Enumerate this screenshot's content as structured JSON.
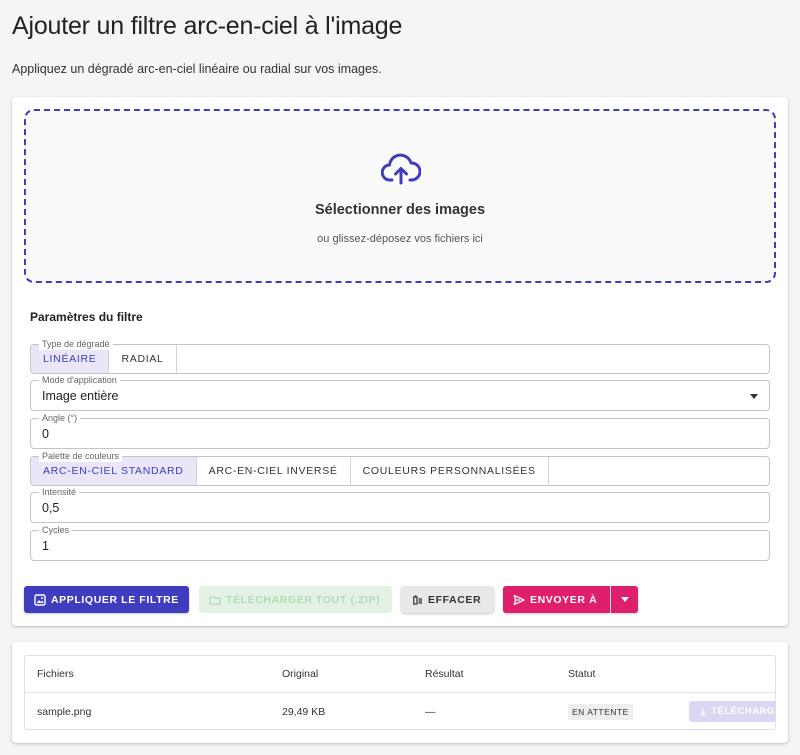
{
  "header": {
    "title": "Ajouter un filtre arc-en-ciel à l'image",
    "subtitle": "Appliquez un dégradé arc-en-ciel linéaire ou radial sur vos images."
  },
  "dropzone": {
    "icon": "cloud-upload-icon",
    "title": "Sélectionner des images",
    "subtitle": "ou glissez-déposez vos fichiers ici"
  },
  "settings": {
    "title": "Paramètres du filtre",
    "gradient_type": {
      "label": "Type de dégradé",
      "options": [
        "LINÉAIRE",
        "RADIAL"
      ],
      "selected": "LINÉAIRE"
    },
    "application_mode": {
      "label": "Mode d'application",
      "value": "Image entière"
    },
    "angle": {
      "label": "Angle (°)",
      "value": "0"
    },
    "palette": {
      "label": "Palette de couleurs",
      "options": [
        "ARC-EN-CIEL STANDARD",
        "ARC-EN-CIEL INVERSÉ",
        "COULEURS PERSONNALISÉES"
      ],
      "selected": "ARC-EN-CIEL STANDARD"
    },
    "intensity": {
      "label": "Intensité",
      "value": "0,5"
    },
    "cycles": {
      "label": "Cycles",
      "value": "1"
    }
  },
  "actions": {
    "apply": "APPLIQUER LE FILTRE",
    "download_all": "TÉLÉCHARGER TOUT (.ZIP)",
    "clear": "EFFACER",
    "send_to": "ENVOYER À"
  },
  "files_table": {
    "headers": [
      "Fichiers",
      "Original",
      "Résultat",
      "Statut"
    ],
    "rows": [
      {
        "name": "sample.png",
        "original": "29,49 KB",
        "result": "—",
        "status": "EN ATTENTE",
        "download": "TÉLÉCHARGER"
      }
    ]
  },
  "colors": {
    "primary": "#3f3dbd",
    "send": "#e01f6c",
    "download_disabled": "#e4f2e5",
    "toggle_active_bg": "#e8e6f7"
  }
}
